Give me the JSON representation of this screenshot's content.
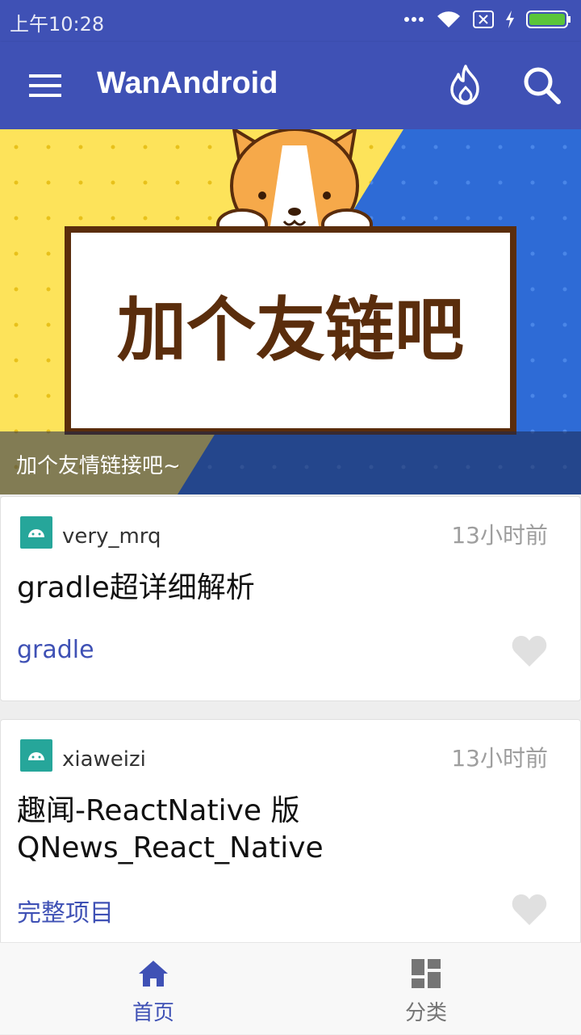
{
  "status_bar": {
    "time": "上午10:28",
    "icons": [
      "more-dots-icon",
      "wifi-icon",
      "sim-x-icon",
      "charging-icon",
      "battery-icon"
    ]
  },
  "app_bar": {
    "title": "WanAndroid",
    "background": "#3f51b5",
    "icons": [
      "menu-icon",
      "fire-icon",
      "search-icon"
    ]
  },
  "banner": {
    "image_text": "加个友链吧",
    "caption": "加个友情链接吧~"
  },
  "articles": [
    {
      "author": "very_mrq",
      "time": "13小时前",
      "title": "gradle超详细解析",
      "tag": "gradle"
    },
    {
      "author": "xiaweizi",
      "time": "13小时前",
      "title_line1": "趣闻-ReactNative 版",
      "title_line2": "QNews_React_Native",
      "tag": "完整项目"
    }
  ],
  "bottom_nav": {
    "items": [
      {
        "label": "首页",
        "icon": "home-icon",
        "active": true
      },
      {
        "label": "分类",
        "icon": "category-icon",
        "active": false
      }
    ],
    "active_color": "#3f51b5",
    "inactive_color": "#757575"
  }
}
